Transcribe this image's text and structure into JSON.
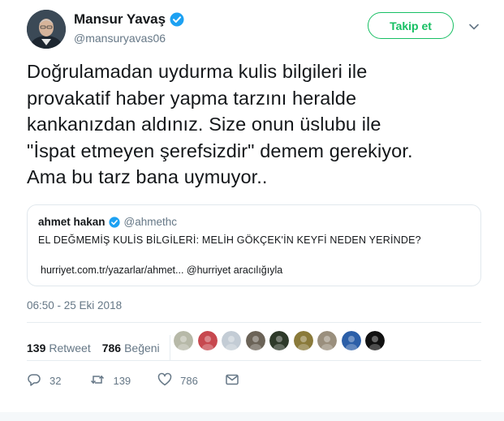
{
  "author": {
    "display_name": "Mansur Yavaş",
    "handle": "@mansuryavas06",
    "verified": true
  },
  "follow_button": {
    "label": "Takip et",
    "color": "#17bf63"
  },
  "tweet": {
    "lines": [
      "Doğrulamadan uydurma kulis bilgileri ile",
      "provakatif haber yapma tarzını heralde",
      "kankanızdan aldınız. Size onun üslubu ile",
      "\"İspat etmeyen şerefsizdir\" demem gerekiyor.",
      "Ama bu tarz bana uymuyor.."
    ]
  },
  "quoted_tweet": {
    "display_name": "ahmet hakan",
    "handle": "@ahmethc",
    "verified": true,
    "text": "EL DEĞMEMİŞ KULİS BİLGİLERİ: MELİH GÖKÇEK'İN KEYFİ NEDEN YERİNDE?",
    "link": "hurriyet.com.tr/yazarlar/ahmet... @hurriyet aracılığıyla"
  },
  "timestamp": "06:50 - 25 Eki 2018",
  "stats": {
    "retweets": {
      "count": "139",
      "label": "Retweet"
    },
    "likes": {
      "count": "786",
      "label": "Beğeni"
    }
  },
  "likers": [
    {
      "icon": "liker-avatar",
      "color": "#b7b9a8"
    },
    {
      "icon": "liker-avatar",
      "color": "#c7484f"
    },
    {
      "icon": "liker-avatar",
      "color": "#c3ccd5"
    },
    {
      "icon": "liker-avatar",
      "color": "#6b6357"
    },
    {
      "icon": "liker-avatar",
      "color": "#2e3a2a"
    },
    {
      "icon": "liker-avatar",
      "color": "#8a7a3a"
    },
    {
      "icon": "liker-avatar",
      "color": "#9a8f7d"
    },
    {
      "icon": "liker-avatar",
      "color": "#2c5fa8"
    },
    {
      "icon": "liker-avatar",
      "color": "#111111"
    }
  ],
  "actions": {
    "reply": {
      "icon": "reply-icon",
      "count": "32"
    },
    "retweet": {
      "icon": "retweet-icon",
      "count": "139"
    },
    "like": {
      "icon": "heart-icon",
      "count": "786"
    },
    "message": {
      "icon": "message-icon"
    }
  },
  "colors": {
    "secondary_text": "#657786",
    "verified_blue": "#1da1f2",
    "border": "#e1e8ed"
  }
}
